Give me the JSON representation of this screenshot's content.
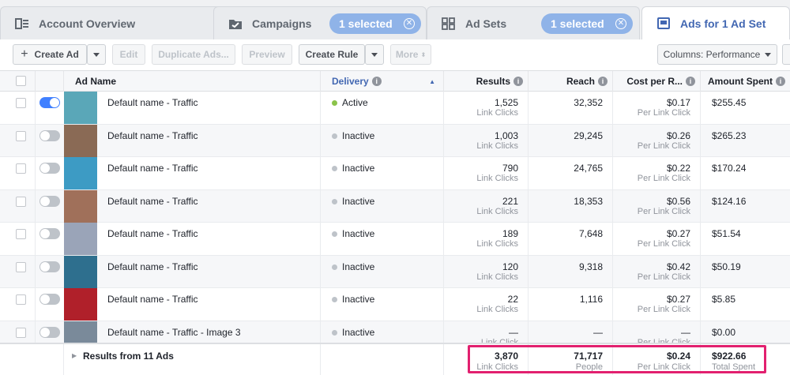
{
  "tabs": {
    "account": "Account Overview",
    "campaigns": "Campaigns",
    "campaigns_selected": "1 selected",
    "adsets": "Ad Sets",
    "adsets_selected": "1 selected",
    "ads": "Ads for 1 Ad Set"
  },
  "toolbar": {
    "create_ad": "Create Ad",
    "edit": "Edit",
    "duplicate": "Duplicate Ads...",
    "preview": "Preview",
    "create_rule": "Create Rule",
    "more": "More",
    "columns": "Columns: Performance"
  },
  "columns": {
    "ad_name": "Ad Name",
    "delivery": "Delivery",
    "results": "Results",
    "reach": "Reach",
    "cost": "Cost per R...",
    "amount": "Amount Spent"
  },
  "rows": [
    {
      "name": "Default name - Traffic",
      "on": true,
      "status": "Active",
      "results": "1,525",
      "results_sub": "Link Clicks",
      "reach": "32,352",
      "cost": "$0.17",
      "cost_sub": "Per Link Click",
      "amount": "$255.45"
    },
    {
      "name": "Default name - Traffic",
      "on": false,
      "status": "Inactive",
      "results": "1,003",
      "results_sub": "Link Clicks",
      "reach": "29,245",
      "cost": "$0.26",
      "cost_sub": "Per Link Click",
      "amount": "$265.23"
    },
    {
      "name": "Default name - Traffic",
      "on": false,
      "status": "Inactive",
      "results": "790",
      "results_sub": "Link Clicks",
      "reach": "24,765",
      "cost": "$0.22",
      "cost_sub": "Per Link Click",
      "amount": "$170.24"
    },
    {
      "name": "Default name - Traffic",
      "on": false,
      "status": "Inactive",
      "results": "221",
      "results_sub": "Link Clicks",
      "reach": "18,353",
      "cost": "$0.56",
      "cost_sub": "Per Link Click",
      "amount": "$124.16"
    },
    {
      "name": "Default name - Traffic",
      "on": false,
      "status": "Inactive",
      "results": "189",
      "results_sub": "Link Clicks",
      "reach": "7,648",
      "cost": "$0.27",
      "cost_sub": "Per Link Click",
      "amount": "$51.54"
    },
    {
      "name": "Default name - Traffic",
      "on": false,
      "status": "Inactive",
      "results": "120",
      "results_sub": "Link Clicks",
      "reach": "9,318",
      "cost": "$0.42",
      "cost_sub": "Per Link Click",
      "amount": "$50.19"
    },
    {
      "name": "Default name - Traffic",
      "on": false,
      "status": "Inactive",
      "results": "22",
      "results_sub": "Link Clicks",
      "reach": "1,116",
      "cost": "$0.27",
      "cost_sub": "Per Link Click",
      "amount": "$5.85"
    },
    {
      "name": "Default name - Traffic - Image 3",
      "on": false,
      "status": "Inactive",
      "results": "—",
      "results_sub": "Link Click",
      "reach": "—",
      "cost": "—",
      "cost_sub": "Per Link Click",
      "amount": "$0.00"
    }
  ],
  "summary": {
    "label": "Results from 11 Ads",
    "results": "3,870",
    "results_sub": "Link Clicks",
    "reach": "71,717",
    "reach_sub": "People",
    "cost": "$0.24",
    "cost_sub": "Per Link Click",
    "amount": "$922.66",
    "amount_sub": "Total Spent"
  },
  "colors": {
    "accent": "#4267b2",
    "toggle_on": "#4080ff",
    "active_dot": "#8bc34a",
    "highlight": "#e2206f"
  },
  "thumbs": [
    "#5aa7b8",
    "#8a6a55",
    "#3d9bc4",
    "#a0705a",
    "#9aa4b8",
    "#2e6f8e",
    "#b0202a",
    "#7a8a9a"
  ]
}
